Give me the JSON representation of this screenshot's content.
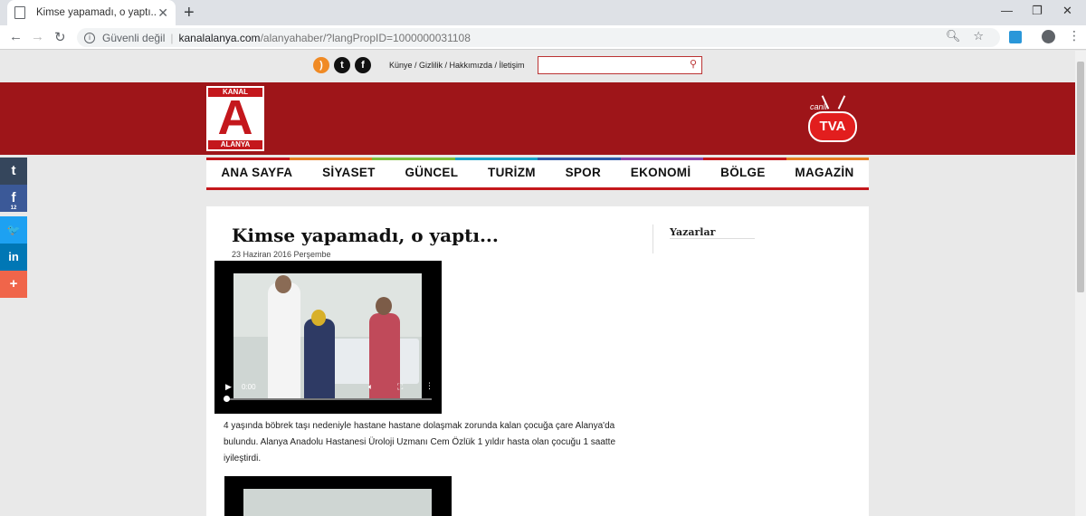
{
  "browser": {
    "tab_title": "Kimse yapamadı, o yaptı...",
    "tab_close": "✕",
    "new_tab": "+",
    "window_controls": [
      "—",
      "❐",
      "✕"
    ],
    "nav": {
      "back": "←",
      "forward": "→",
      "reload": "↻"
    },
    "security_label": "Güvenli değil",
    "url_host": "kanalalanya.com",
    "url_path": "/alanyahaber/?langPropID=1000000031108",
    "omni_icons": [
      "zoom-icon",
      "star-icon"
    ],
    "menu_glyph": "⋮"
  },
  "site": {
    "top_links": "Künye / Gizlilik / Hakkımızda / İletişim",
    "social_glyphs": {
      "rss": ")",
      "twitter": "t",
      "facebook": "f"
    },
    "search_glyph": "⚲",
    "logo_kanal": "KANAL",
    "logo_a": "A",
    "logo_alanya": "ALANYA",
    "tv_canli": "canlı",
    "tv_label": "TVA",
    "nav_items": [
      "ANA SAYFA",
      "SİYASET",
      "GÜNCEL",
      "TURİZM",
      "SPOR",
      "EKONOMİ",
      "BÖLGE",
      "MAGAZİN"
    ],
    "nav_colors": [
      "#c4171c",
      "#e67e22",
      "#7cbf3a",
      "#1aa3c8",
      "#2e5aa8",
      "#8e44ad",
      "#c4171c",
      "#e67e22"
    ]
  },
  "share_bar": {
    "tumblr": "t",
    "facebook": "f",
    "facebook_count": "12",
    "twitter": "🐦",
    "linkedin": "in",
    "more": "+",
    "colors": {
      "tumblr": "#35465c",
      "facebook": "#3b5998",
      "twitter": "#1da1f2",
      "linkedin": "#0077b5",
      "more": "#f0654a"
    }
  },
  "article": {
    "title": "Kimse yapamadı, o yaptı...",
    "date": "23 Haziran 2016 Perşembe",
    "video_time": "0:00",
    "body": "4 yaşında böbrek taşı nedeniyle hastane hastane dolaşmak zorunda kalan çocuğa çare Alanya'da bulundu.  Alanya Anadolu Hastanesi Üroloji Uzmanı Cem Özlük 1 yıldır hasta olan çocuğu 1 saatte iyileştirdi."
  },
  "sidebar": {
    "title": "Yazarlar"
  }
}
